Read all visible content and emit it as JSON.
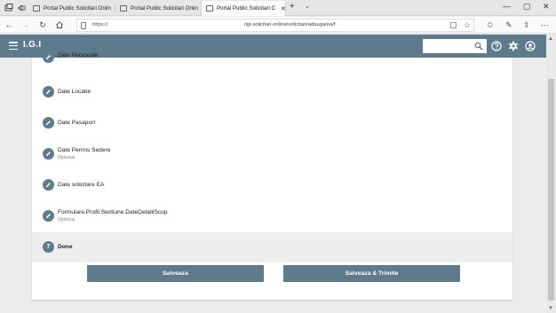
{
  "browser": {
    "tabs": [
      {
        "title": "Portal Public Solicitari Onlin",
        "active": false
      },
      {
        "title": "Portal Public Solicitari Onlin",
        "active": false
      },
      {
        "title": "Portal Public Solicitari C",
        "active": true
      }
    ],
    "url_protocol": "https://",
    "url_path": "/igi-solicitari-online/solicitari/adauga/ea/f"
  },
  "header": {
    "brand": "I.G.I",
    "search_placeholder": "",
    "icons": [
      "menu-icon",
      "search-icon",
      "help-icon",
      "settings-icon",
      "user-icon"
    ],
    "bar_color": "#5d7b8c"
  },
  "steps": [
    {
      "label": "Date Personale",
      "sub": ""
    },
    {
      "label": "Date Locatie",
      "sub": ""
    },
    {
      "label": "Date Pasaport",
      "sub": ""
    },
    {
      "label": "Date Permis Sedere",
      "sub": "Optional"
    },
    {
      "label": "Date solicitare EA",
      "sub": ""
    },
    {
      "label": "Formulare.Profil.Sectiune.DateDetaliiScop",
      "sub": "Optional"
    },
    {
      "label": "Done",
      "sub": "",
      "number": "7"
    }
  ],
  "actions": {
    "save": "Salveaza",
    "save_send": "Salveaza & Trimite"
  }
}
